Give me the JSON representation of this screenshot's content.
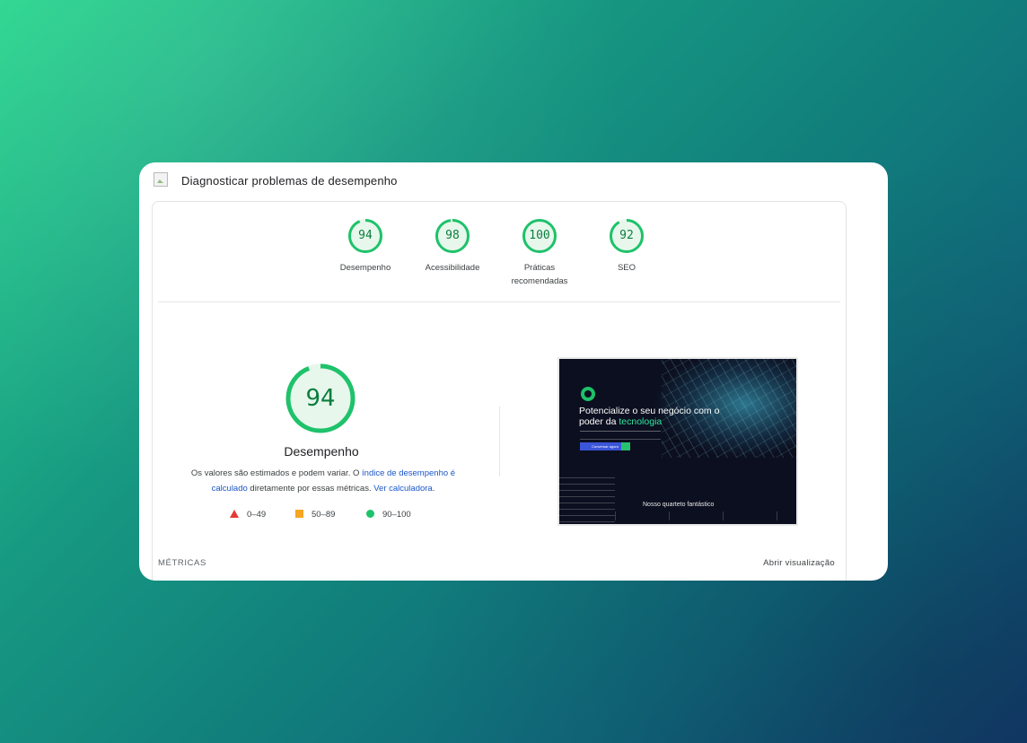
{
  "header": {
    "title": "Diagnosticar problemas de desempenho"
  },
  "scores": [
    {
      "value": "94",
      "label": "Desempenho",
      "fraction": 0.94
    },
    {
      "value": "98",
      "label": "Acessibilidade",
      "fraction": 0.98
    },
    {
      "value": "100",
      "label": "Práticas recomendadas",
      "label_line1": "Práticas",
      "label_line2": "recomendadas",
      "fraction": 1.0
    },
    {
      "value": "92",
      "label": "SEO",
      "fraction": 0.92
    }
  ],
  "performance": {
    "score": "94",
    "fraction": 0.94,
    "title": "Desempenho",
    "desc_prefix": "Os valores são estimados e podem variar. O ",
    "desc_link1": "índice de desempenho é calculado",
    "desc_middle": " diretamente por essas métricas. ",
    "desc_link2": "Ver calculadora",
    "desc_suffix": "."
  },
  "legend": [
    {
      "shape": "triangle",
      "range": "0–49",
      "color": "#e53935"
    },
    {
      "shape": "square",
      "range": "50–89",
      "color": "#f5a623"
    },
    {
      "shape": "circle",
      "range": "90–100",
      "color": "#1ec26a"
    }
  ],
  "screenshot": {
    "headline_part1": "Potencialize o seu negócio com o poder da ",
    "headline_accent": "tecnologia",
    "cta": "Conversar agora",
    "section": "Nosso quarteto fantástico"
  },
  "footer": {
    "metrics_label": "MÉTRICAS",
    "open_view": "Abrir visualização"
  },
  "colors": {
    "pass_green": "#0b7d3e",
    "ring_green": "#1ec26a",
    "link_blue": "#1a56c9"
  }
}
